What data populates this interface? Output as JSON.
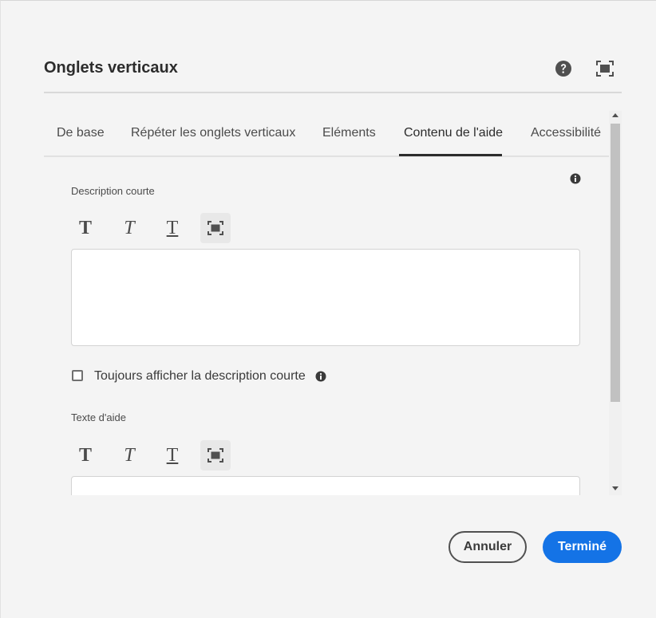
{
  "dialog": {
    "title": "Onglets verticaux",
    "icons": {
      "help": "help-icon",
      "fullscreen": "fullscreen-icon"
    }
  },
  "tabs": [
    {
      "label": "De base"
    },
    {
      "label": "Répéter les onglets verticaux"
    },
    {
      "label": "Eléments"
    },
    {
      "label": "Contenu de l'aide",
      "active": true
    },
    {
      "label": "Accessibilité"
    }
  ],
  "fields": {
    "short_description": {
      "label": "Description courte",
      "value": ""
    },
    "always_show": {
      "label": "Toujours afficher la description courte",
      "checked": false
    },
    "help_text": {
      "label": "Texte d'aide",
      "value": ""
    }
  },
  "rte_toolbar": [
    {
      "icon": "bold-icon",
      "glyph": "T"
    },
    {
      "icon": "italic-icon",
      "glyph": "T"
    },
    {
      "icon": "underline-icon",
      "glyph": "T"
    },
    {
      "icon": "expand-icon"
    }
  ],
  "buttons": {
    "cancel": "Annuler",
    "done": "Terminé"
  },
  "colors": {
    "accent": "#1473e6",
    "background": "#f4f4f4"
  }
}
